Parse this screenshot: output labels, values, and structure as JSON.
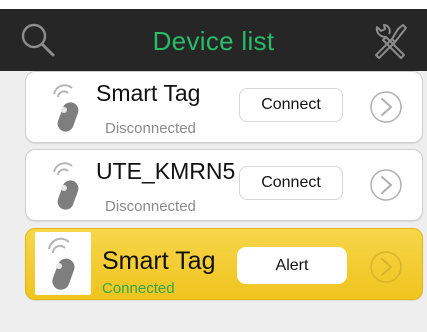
{
  "header": {
    "title": "Device list",
    "search_icon": "search-icon",
    "tools_icon": "tools-icon"
  },
  "devices": [
    {
      "name": "Smart Tag",
      "status": "Disconnected",
      "action_label": "Connect",
      "icon": "smart-tag-icon"
    },
    {
      "name": "UTE_KMRN5",
      "status": "Disconnected",
      "action_label": "Connect",
      "icon": "smart-tag-icon"
    },
    {
      "name": "Smart Tag",
      "status": "Connected",
      "action_label": "Alert",
      "icon": "smart-tag-icon"
    }
  ],
  "colors": {
    "header_bg": "#262626",
    "title_green": "#26bc68",
    "connected_green": "#2ea84c",
    "active_card": "#f0c41e"
  }
}
